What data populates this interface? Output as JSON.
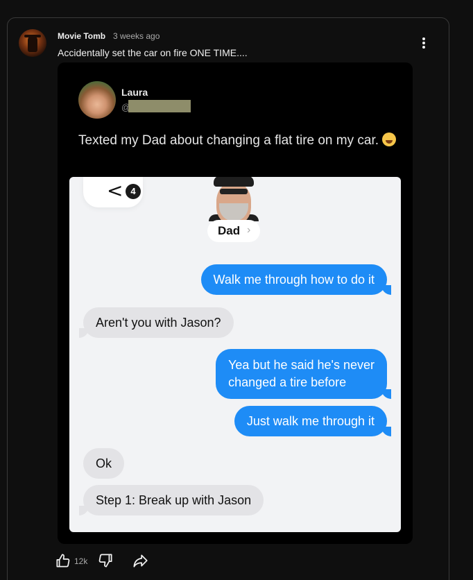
{
  "post": {
    "author": "Movie Tomb",
    "timestamp": "3 weeks ago",
    "text": "Accidentally set the car on fire ONE TIME...."
  },
  "image": {
    "tweet": {
      "name": "Laura",
      "handle_prefix": "@",
      "text": "Texted my Dad about changing a flat tire on my car."
    },
    "chat": {
      "back_count": "4",
      "back_chevron": "<",
      "contact_name": "Dad",
      "contact_chevron": "›",
      "messages": [
        {
          "from": "me",
          "text": "Walk me through how to do it"
        },
        {
          "from": "dad",
          "text": "Aren't you with Jason?"
        },
        {
          "from": "me",
          "line1": "Yea but he said he's never",
          "line2": "changed a tire before"
        },
        {
          "from": "me",
          "text": "Just walk me through it"
        },
        {
          "from": "dad",
          "text": "Ok"
        },
        {
          "from": "dad",
          "text": "Step 1: Break up with Jason"
        }
      ]
    }
  },
  "actions": {
    "like_count": "12k",
    "like_icon": "thumbs-up-icon",
    "dislike_icon": "thumbs-down-icon",
    "share_icon": "share-icon",
    "menu_icon": "more-vert-icon"
  },
  "colors": {
    "background": "#0f0f0f",
    "sent_bubble": "#1e8cf6",
    "received_bubble": "#e3e3e6"
  }
}
